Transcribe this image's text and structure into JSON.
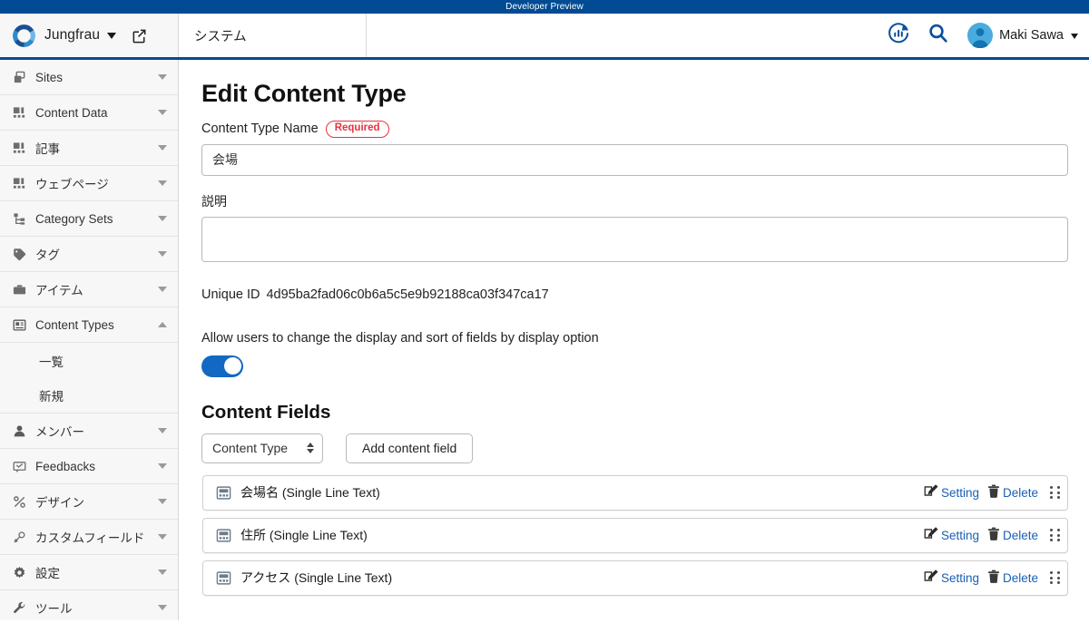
{
  "banner": {
    "text": "Developer Preview",
    "color": "#004b93"
  },
  "header": {
    "brand_name": "Jungfrau",
    "brand_caret_icon": "chevron-down-icon",
    "edit_icon": "edit-square-icon",
    "tab_label": "システム",
    "analytics_icon": "chart-refresh-icon",
    "search_icon": "search-icon",
    "avatar_icon": "user-avatar",
    "user_name": "Maki Sawa",
    "user_caret_icon": "chevron-down-icon",
    "accent_color": "#004b93"
  },
  "sidebar": {
    "items": [
      {
        "label": "Sites",
        "icon": "sites-icon",
        "arrow": "down",
        "sub": []
      },
      {
        "label": "Content Data",
        "icon": "content-data-icon",
        "arrow": "down",
        "sub": []
      },
      {
        "label": "記事",
        "icon": "content-data-icon",
        "arrow": "down",
        "sub": []
      },
      {
        "label": "ウェブページ",
        "icon": "content-data-icon",
        "arrow": "down",
        "sub": []
      },
      {
        "label": "Category Sets",
        "icon": "category-sets-icon",
        "arrow": "down",
        "sub": []
      },
      {
        "label": "タグ",
        "icon": "tag-icon",
        "arrow": "down",
        "sub": []
      },
      {
        "label": "アイテム",
        "icon": "item-briefcase-icon",
        "arrow": "down",
        "sub": []
      },
      {
        "label": "Content Types",
        "icon": "content-types-icon",
        "arrow": "up",
        "sub": [
          "一覧",
          "新規"
        ]
      },
      {
        "label": "メンバー",
        "icon": "member-icon",
        "arrow": "down",
        "sub": []
      },
      {
        "label": "Feedbacks",
        "icon": "feedback-icon",
        "arrow": "down",
        "sub": []
      },
      {
        "label": "デザイン",
        "icon": "design-icon",
        "arrow": "down",
        "sub": []
      },
      {
        "label": "カスタムフィールド",
        "icon": "custom-field-icon",
        "arrow": "down",
        "sub": []
      },
      {
        "label": "設定",
        "icon": "gear-icon",
        "arrow": "down",
        "sub": []
      },
      {
        "label": "ツール",
        "icon": "wrench-icon",
        "arrow": "down",
        "sub": []
      }
    ]
  },
  "main": {
    "page_title": "Edit Content Type",
    "content_type_name_label": "Content Type Name",
    "required_badge": "Required",
    "required_color": "#e8323c",
    "content_type_name_value": "会場",
    "content_type_name_placeholder": "",
    "description_label": "説明",
    "description_value": "",
    "description_placeholder": "",
    "unique_id_label": "Unique ID",
    "unique_id_value": "4d95ba2fad06c0b6a5c5e9b92188ca03f347ca17",
    "allow_users_label": "Allow users to change the display and sort of fields by display option",
    "allow_users_toggle_on": true,
    "toggle_color": "#1268c3",
    "content_fields_title": "Content Fields",
    "field_type_select_value": "Content Type",
    "field_type_select_icon": "stepper-icon",
    "add_field_button": "Add content field",
    "fields": [
      {
        "icon": "single-line-text-icon",
        "name": "会場名 (Single Line Text)",
        "setting_label": "Setting",
        "setting_icon": "edit-icon",
        "delete_label": "Delete",
        "delete_icon": "trash-icon",
        "drag_icon": "drag-handle-icon"
      },
      {
        "icon": "single-line-text-icon",
        "name": "住所 (Single Line Text)",
        "setting_label": "Setting",
        "setting_icon": "edit-icon",
        "delete_label": "Delete",
        "delete_icon": "trash-icon",
        "drag_icon": "drag-handle-icon"
      },
      {
        "icon": "single-line-text-icon",
        "name": "アクセス (Single Line Text)",
        "setting_label": "Setting",
        "setting_icon": "edit-icon",
        "delete_label": "Delete",
        "delete_icon": "trash-icon",
        "drag_icon": "drag-handle-icon"
      }
    ],
    "link_color": "#1a5fb4"
  }
}
